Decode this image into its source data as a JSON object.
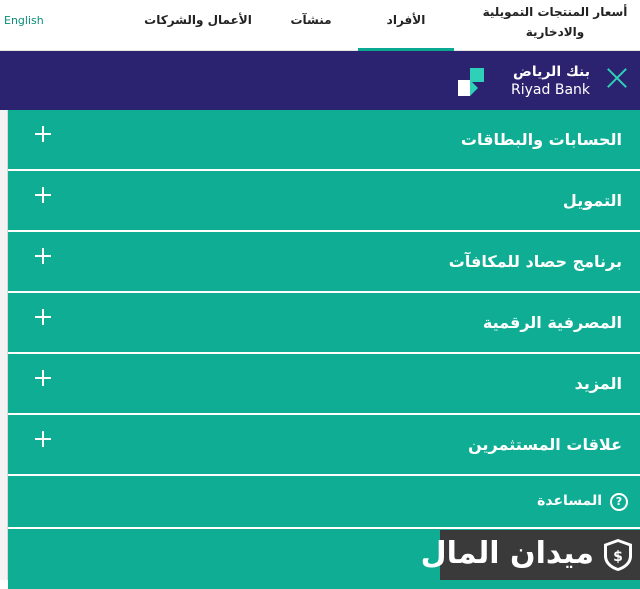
{
  "topnav": {
    "language": "English",
    "items": [
      {
        "label": "أسعار المنتجات التمويلية والادخارية"
      },
      {
        "label": "الأفراد"
      },
      {
        "label": "منشآت"
      },
      {
        "label": "الأعمال والشركات"
      }
    ],
    "active_item": "الأفراد",
    "accent_color": "#0aa890"
  },
  "menubar": {
    "background_color": "#2b2270",
    "logo_arabic": "بنك الرياض",
    "logo_english": "Riyad Bank",
    "close_icon": "close-icon"
  },
  "menu": {
    "row_color": "#0fae94",
    "items": [
      {
        "label": "الحسابات والبطاقات"
      },
      {
        "label": "التمويل"
      },
      {
        "label": "برنامج حصاد للمكافآت"
      },
      {
        "label": "المصرفية الرقمية"
      },
      {
        "label": "المزيد"
      },
      {
        "label": "علاقات المستثمرين"
      }
    ],
    "help_label": "المساعدة"
  },
  "watermark": {
    "text": "ميدان المال"
  }
}
